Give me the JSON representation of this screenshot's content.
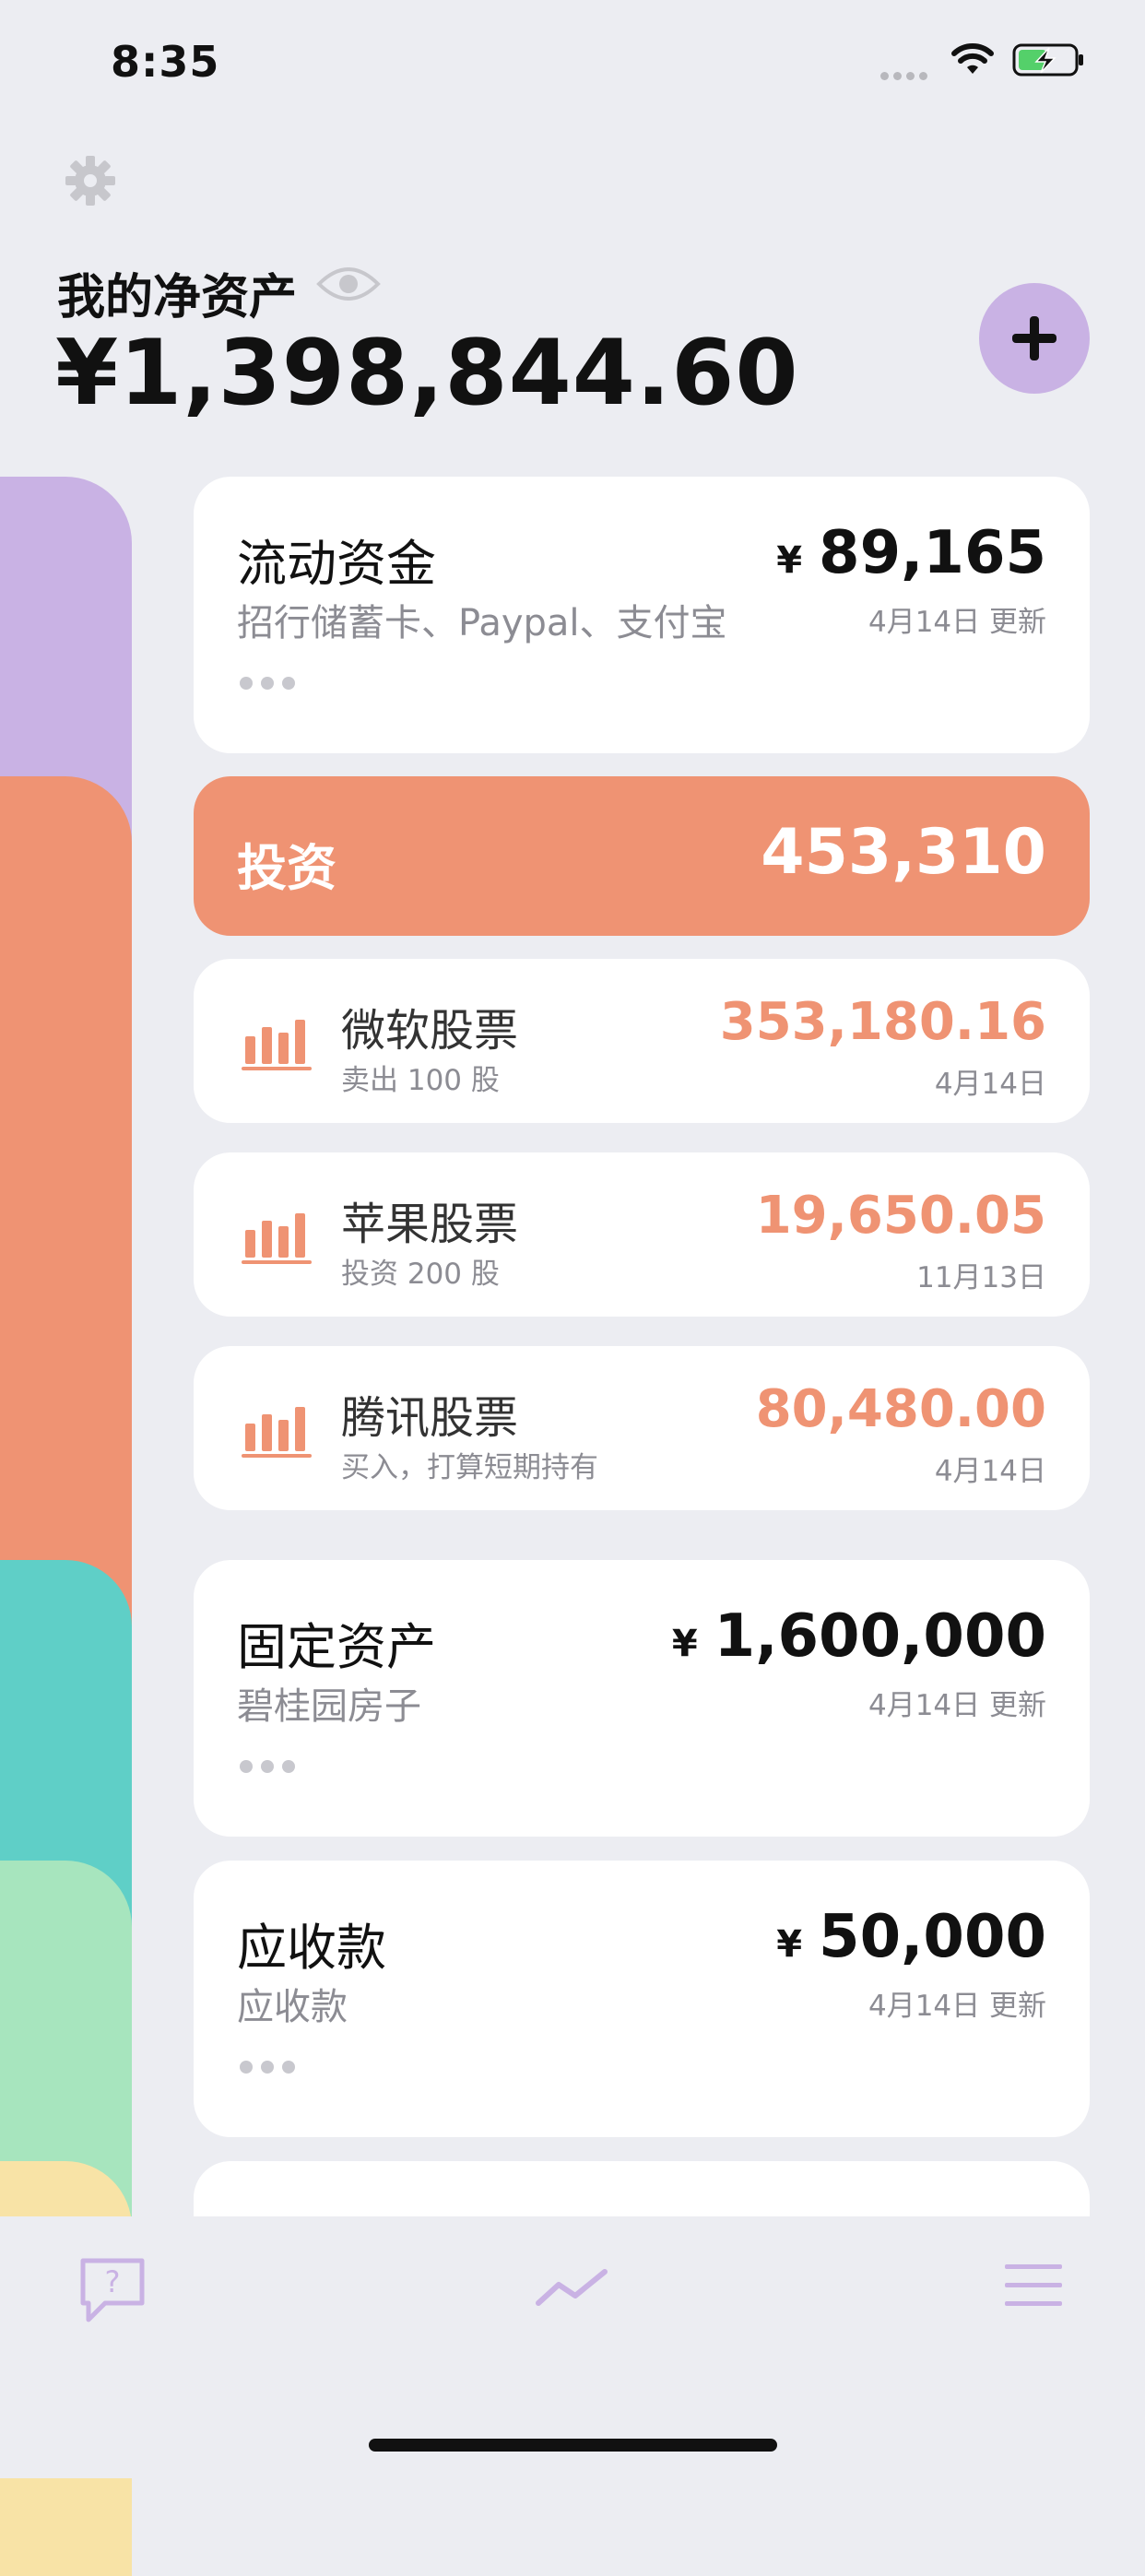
{
  "status_bar": {
    "time": "8:35"
  },
  "header": {
    "title": "我的净资产",
    "net_worth": "¥1,398,844.60"
  },
  "colors": {
    "purple": "#C9B2E4",
    "orange": "#EF9373",
    "teal": "#5FCFC7",
    "green": "#A7E5BE",
    "yellow": "#F8E3A6"
  },
  "categories": [
    {
      "name": "流动资金",
      "desc": "招行储蓄卡、Paypal、支付宝",
      "currency": "¥",
      "amount": "89,165",
      "date": "4月14日 更新"
    },
    {
      "name": "固定资产",
      "desc": "碧桂园房子",
      "currency": "¥",
      "amount": "1,600,000",
      "date": "4月14日 更新"
    },
    {
      "name": "应收款",
      "desc": "应收款",
      "currency": "¥",
      "amount": "50,000",
      "date": "4月14日 更新"
    }
  ],
  "investment": {
    "label": "投资",
    "total": "453,310",
    "items": [
      {
        "name": "微软股票",
        "note": "卖出 100 股",
        "value": "353,180.16",
        "date": "4月14日"
      },
      {
        "name": "苹果股票",
        "note": "投资 200 股",
        "value": "19,650.05",
        "date": "11月13日"
      },
      {
        "name": "腾讯股票",
        "note": "买入，打算短期持有",
        "value": "80,480.00",
        "date": "4月14日"
      }
    ]
  },
  "tabbar": {
    "icons": [
      "help-icon",
      "trend-chart-icon",
      "menu-icon"
    ]
  }
}
